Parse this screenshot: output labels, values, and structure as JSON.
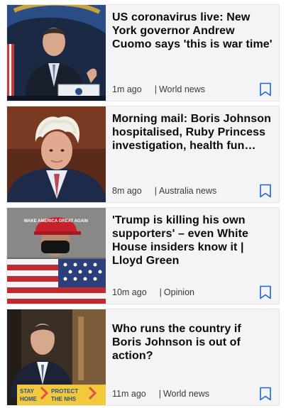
{
  "articles": [
    {
      "headline": "US coronavirus live: New York governor Andrew Cuomo says 'this is war time'",
      "time": "1m ago",
      "section": "World news",
      "image_icon": "photo-andrew-cuomo"
    },
    {
      "headline": "Morning mail: Boris Johnson hospitalised, Ruby Princess investigation, health fun…",
      "time": "8m ago",
      "section": "Australia news",
      "image_icon": "photo-boris-johnson"
    },
    {
      "headline": "'Trump is killing his own supporters' – even White House insiders know it | Lloyd Green",
      "time": "10m ago",
      "section": "Opinion",
      "image_icon": "photo-masked-supporter"
    },
    {
      "headline": "Who runs the country if Boris Johnson is out of action?",
      "time": "11m ago",
      "section": "World news",
      "image_icon": "photo-dominic-raab"
    }
  ],
  "separator": "|",
  "image_text": {
    "cap_text": "MAKE AMERICA GREAT AGAIN",
    "podium_word1": "STAY",
    "podium_word2": "HOME",
    "podium_word3": "PROTECT",
    "podium_word4": "THE NHS"
  },
  "colors": {
    "accent": "#1e66d6",
    "card_bg": "#f4f4f6",
    "headline": "#0a0a0a",
    "meta": "#3a3a3a"
  },
  "icons": {
    "bookmark": "bookmark-icon"
  }
}
